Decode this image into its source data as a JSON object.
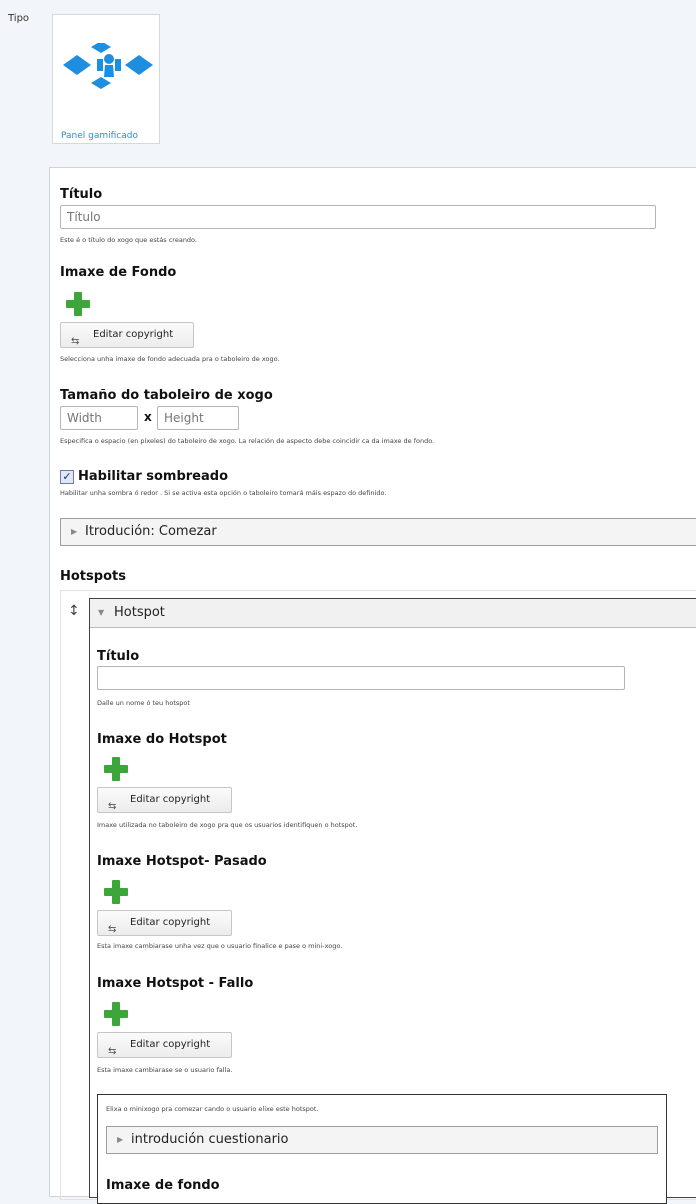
{
  "type_section": {
    "label": "Tipo",
    "tile_caption": "Panel gamificado",
    "logo_icon": "gamified-panel-logo",
    "accent": "#1e8ee0"
  },
  "title_section": {
    "label": "Título",
    "placeholder": "Título",
    "description": "Este é o título do xogo que estás creando."
  },
  "background_section": {
    "label": "Imaxe de Fondo",
    "copyright_button": "Editar copyright",
    "description": "Selecciona unha imaxe de fondo adecuada pra o taboleiro de xogo."
  },
  "size_section": {
    "label": "Tamaño do taboleiro de xogo",
    "width_placeholder": "Width",
    "separator": "x",
    "height_placeholder": "Height",
    "description": "Especifica o espacio (en píxeles) do taboleiro de xogo. La relación de aspecto debe coincidir ca da imaxe de fondo."
  },
  "shadow_section": {
    "label": "Habilitar sombreado",
    "checked": true,
    "description": "Habilitar unha sombra ó redor . Si se activa esta opción o taboleiro tomará máis espazo do definido."
  },
  "intro_collapsible": {
    "label": "Itrodución: Comezar"
  },
  "hotspots": {
    "label": "Hotspots",
    "item": {
      "header": "Hotspot",
      "title_label": "Título",
      "title_description": "Dalle un nome ó teu hotspot",
      "image_label": "Imaxe do Hotspot",
      "image_copyright": "Editar copyright",
      "image_description": "Imaxe utilizada no taboleiro de xogo pra que os usuarios identifiquen o hotspot.",
      "passed_label": "Imaxe Hotspot- Pasado",
      "passed_copyright": "Editar copyright",
      "passed_description": "Esta imaxe cambiarase unha vez que o usuario finalice e pase o mini-xogo.",
      "failed_label": "Imaxe Hotspot - Fallo",
      "failed_copyright": "Editar copyright",
      "failed_description": "Esta imaxe cambiarase se o usuario falla.",
      "minigame": {
        "description": "Elixa o minixogo pra comezar cando o usuario elixe este hotspot.",
        "collapsible_label": "introdución cuestionario",
        "bg_label": "Imaxe de fondo"
      }
    }
  },
  "colors": {
    "check": "#1c2d6e",
    "plus": "#3da63a",
    "link": "#2a8fd3"
  }
}
